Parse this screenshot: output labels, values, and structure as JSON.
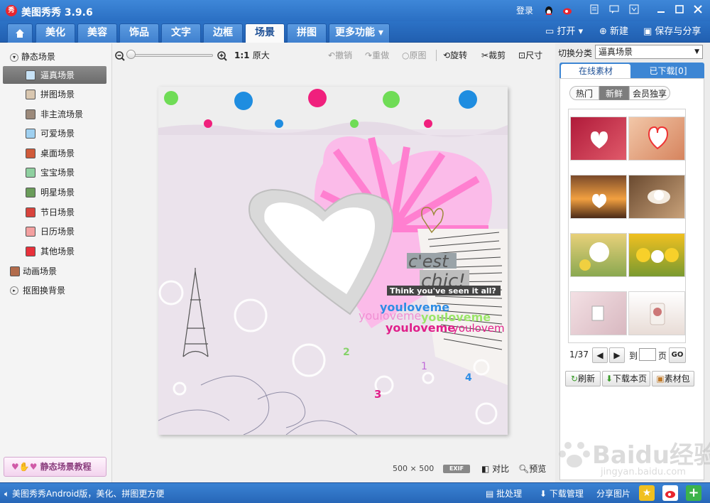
{
  "app": {
    "title": "美图秀秀 3.9.6",
    "logo_text": "秀",
    "login": "登录"
  },
  "tabs": [
    {
      "label": "⌂"
    },
    {
      "label": "美化"
    },
    {
      "label": "美容"
    },
    {
      "label": "饰品"
    },
    {
      "label": "文字"
    },
    {
      "label": "边框"
    },
    {
      "label": "场景"
    },
    {
      "label": "拼图"
    },
    {
      "label": "更多功能 ▾"
    }
  ],
  "top_actions": {
    "open": "打开",
    "new": "新建",
    "save_share": "保存与分享"
  },
  "left": {
    "static_group": "静态场景",
    "items": [
      "逼真场景",
      "拼图场景",
      "非主流场景",
      "可爱场景",
      "桌面场景",
      "宝宝场景",
      "明星场景",
      "节日场景",
      "日历场景",
      "其他场景"
    ],
    "animated": "动画场景",
    "cutout": "抠图换背景",
    "tutorial": "静态场景教程"
  },
  "toolbar": {
    "zoom_1to1": "1:1",
    "original_size": "原大",
    "undo": "撤销",
    "redo": "重做",
    "original": "原图",
    "rotate": "旋转",
    "crop": "裁剪",
    "size": "尺寸"
  },
  "canvas": {
    "text_cest": "c'est",
    "text_chic": "chic!",
    "text_think": "Think you've seen it all?",
    "text_love1": "youloveme",
    "text_love2": "youloveme",
    "text_love3": "youloveme",
    "text_love4": "youloveme",
    "text_love5": "youlovem",
    "num2": "2",
    "num1": "1",
    "num3": "3",
    "num4": "4"
  },
  "bottom": {
    "dims": "500 × 500",
    "exif": "EXIF",
    "compare": "对比",
    "preview": "预览"
  },
  "right": {
    "switch_label": "切换分类",
    "switch_value": "逼真场景",
    "tab_online": "在线素材",
    "tab_downloaded": "已下载[0]",
    "filters": [
      "热门",
      "新鲜",
      "会员独享"
    ],
    "page": "1/37",
    "goto_label": "到",
    "page_suffix": "页",
    "go": "GO",
    "refresh": "刷新",
    "download_page": "下载本页",
    "material_pack": "素材包"
  },
  "status": {
    "promo": "美图秀秀Android版，美化、拼图更方便",
    "batch": "批处理",
    "download_manager": "下载管理",
    "share_image": "分享图片"
  },
  "watermark": {
    "brand": "Baidu经验",
    "url": "jingyan.baidu.com"
  },
  "colors": {
    "title_blue": "#2a6fc3",
    "accent_pink": "#ff7fd0",
    "panel_blue": "#3d86d4"
  }
}
